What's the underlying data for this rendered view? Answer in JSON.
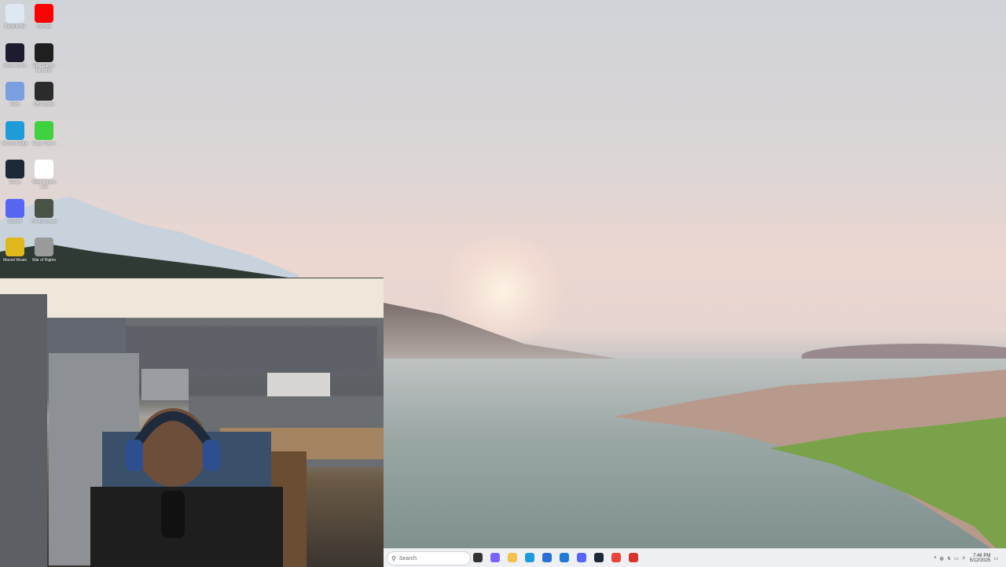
{
  "desktop_icons": [
    {
      "label": "Recycle Bin",
      "icon": "recycle-bin-icon",
      "color": "#dfe8f2"
    },
    {
      "label": "YouTube",
      "icon": "youtube-icon",
      "color": "#ff0000"
    },
    {
      "label": "Stream Deck",
      "icon": "stream-deck-icon",
      "color": "#1c1c2e"
    },
    {
      "label": "Epic Games Launcher",
      "icon": "epic-games-icon",
      "color": "#1f1f1f"
    },
    {
      "label": "Paint",
      "icon": "paint-icon",
      "color": "#7a9ee0"
    },
    {
      "label": "OBS Studio",
      "icon": "obs-icon",
      "color": "#2b2b2b"
    },
    {
      "label": "Microsoft Edge",
      "icon": "edge-icon",
      "color": "#1f9bd8"
    },
    {
      "label": "Razer Cortex",
      "icon": "razer-cortex-icon",
      "color": "#3fd13f"
    },
    {
      "label": "Steam",
      "icon": "steam-icon",
      "color": "#1b2838"
    },
    {
      "label": "Meta Horizon Link",
      "icon": "meta-icon",
      "color": "#ffffff"
    },
    {
      "label": "Discord",
      "icon": "discord-icon",
      "color": "#5865f2"
    },
    {
      "label": "Hell Let Loose",
      "icon": "hell-let-loose-icon",
      "color": "#4a5245"
    },
    {
      "label": "Marvel Rivals",
      "icon": "marvel-rivals-icon",
      "color": "#e1b81b"
    },
    {
      "label": "War of Rights",
      "icon": "war-of-rights-icon",
      "color": "#9a9a9a"
    }
  ],
  "taskbar": {
    "search_placeholder": "Search",
    "pinned": [
      {
        "name": "task-view-icon",
        "color": "#333333"
      },
      {
        "name": "copilot-icon",
        "color": "#7b61ff"
      },
      {
        "name": "file-explorer-icon",
        "color": "#f2c14e"
      },
      {
        "name": "edge-taskbar-icon",
        "color": "#1f9bd8"
      },
      {
        "name": "store-icon",
        "color": "#2a6fd6"
      },
      {
        "name": "vscode-icon",
        "color": "#1f7bd1"
      },
      {
        "name": "discord-taskbar-icon",
        "color": "#5865f2"
      },
      {
        "name": "steam-taskbar-icon",
        "color": "#1b2838"
      },
      {
        "name": "chrome-icon",
        "color": "#e8453c"
      },
      {
        "name": "app-icon",
        "color": "#d9342b"
      }
    ],
    "time": "7:46 PM",
    "date": "5/12/2025"
  }
}
